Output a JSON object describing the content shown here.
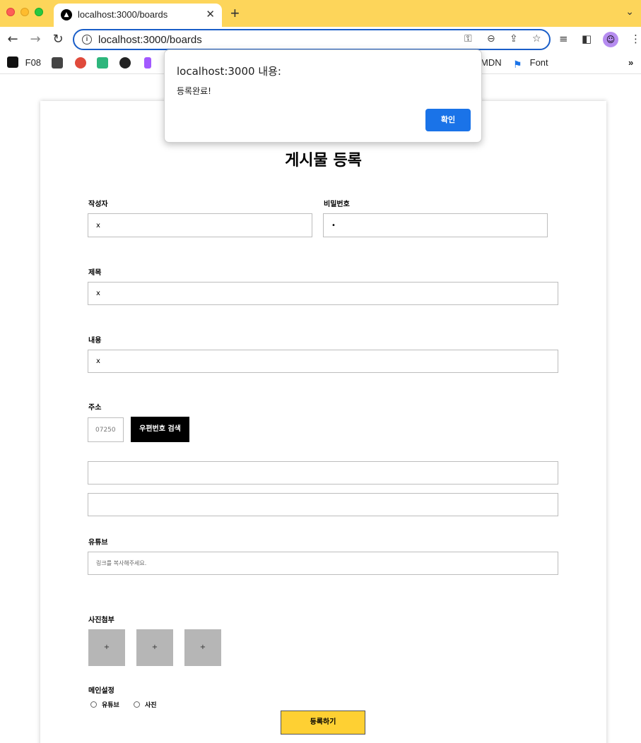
{
  "browser": {
    "tab_title": "localhost:3000/boards",
    "tab_close": "✕",
    "new_tab": "+",
    "url": "localhost:3000/boards",
    "bookmarks": [
      {
        "label": "F08",
        "icon": "f08-icon"
      },
      {
        "label": "MDN",
        "icon": "mdn-icon"
      },
      {
        "label": "Font",
        "icon": "flag-icon"
      }
    ],
    "more_bookmarks": "»"
  },
  "dialog": {
    "title": "localhost:3000 내용:",
    "message": "등록완료!",
    "ok_label": "확인",
    "button_color": "#1a73e8"
  },
  "form": {
    "title": "게시물 등록",
    "writer_label": "작성자",
    "writer_value": "x",
    "password_label": "비밀번호",
    "password_value": "•",
    "subject_label": "제목",
    "subject_value": "x",
    "contents_label": "내용",
    "contents_value": "x",
    "address_label": "주소",
    "zipcode": "07250",
    "zipcode_button": "우편번호 검색",
    "address1": "",
    "address2": "",
    "youtube_label": "유튜브",
    "youtube_placeholder": "링크를 복사해주세요.",
    "photo_label": "사진첨부",
    "photo_add": "+",
    "main_setting_label": "메인설정",
    "radio_youtube": "유튜브",
    "radio_photo": "사진",
    "submit_label": "등록하기",
    "submit_color": "#fed033"
  }
}
